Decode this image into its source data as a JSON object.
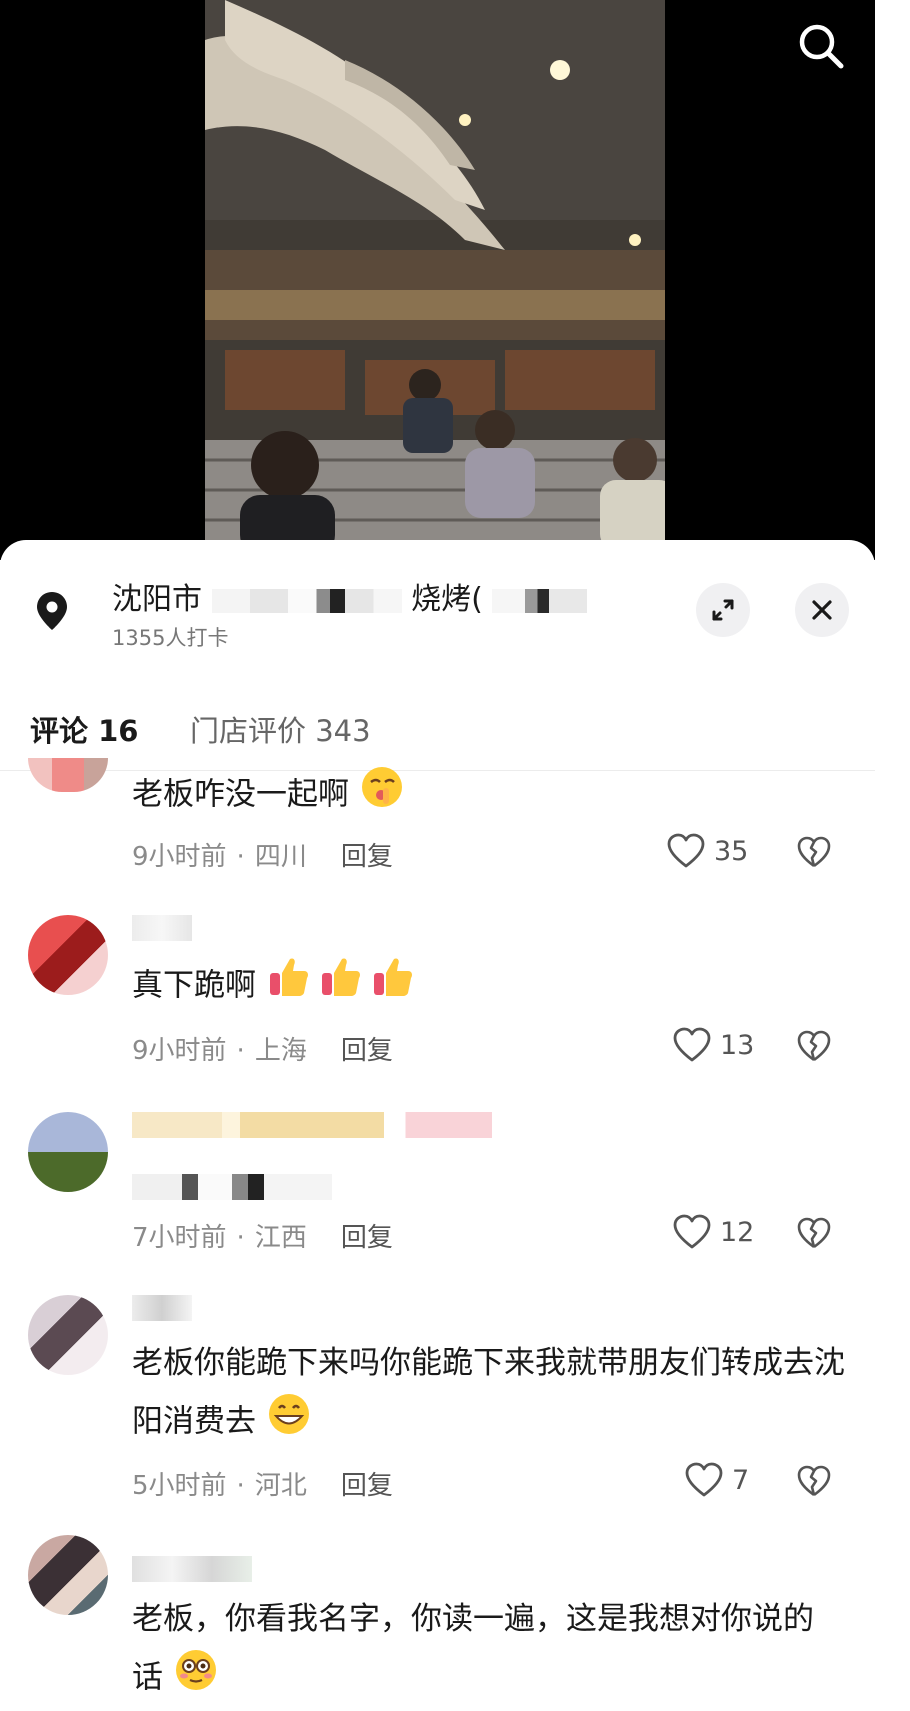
{
  "location": {
    "name_prefix": "沈阳市",
    "name_suffix": "烧烤(",
    "checkins": "1355人打卡"
  },
  "tabs": [
    {
      "label": "评论 16",
      "active": true
    },
    {
      "label": "门店评价 343",
      "active": false
    }
  ],
  "comments": [
    {
      "text": "老板咋没一起啊",
      "time": "9小时前",
      "region": "四川",
      "reply": "回复",
      "likes": "35",
      "emoji": "shushing-face"
    },
    {
      "text": "真下跪啊",
      "time": "9小时前",
      "region": "上海",
      "reply": "回复",
      "likes": "13",
      "emoji": "thumbs-up"
    },
    {
      "text": "",
      "time": "7小时前",
      "region": "江西",
      "reply": "回复",
      "likes": "12"
    },
    {
      "text": "老板你能跪下来吗你能跪下来我就带朋友们转成去沈阳消费去",
      "time": "5小时前",
      "region": "河北",
      "reply": "回复",
      "likes": "7",
      "emoji": "grinning-face"
    },
    {
      "text": "老板，你看我名字，你读一遍，这是我想对你说的话",
      "emoji": "flushed-face"
    }
  ],
  "separator": "·",
  "colors": {
    "accent": "#1a1a1a",
    "muted": "#8a8a8a",
    "sheet_bg": "#ffffff",
    "video_bg": "#000000"
  }
}
